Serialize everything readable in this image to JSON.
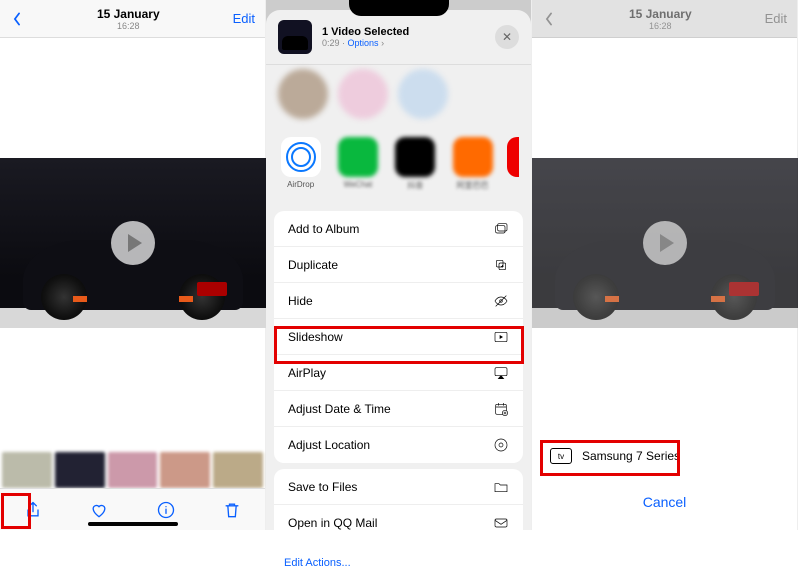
{
  "screen1": {
    "date": "15 January",
    "time": "16:28",
    "edit": "Edit"
  },
  "screen2": {
    "selected": "1 Video Selected",
    "duration": "0:29",
    "options": "Options",
    "airdrop_label": "AirDrop",
    "actions_group1": [
      "Add to Album",
      "Duplicate",
      "Hide",
      "Slideshow",
      "AirPlay",
      "Adjust Date & Time",
      "Adjust Location"
    ],
    "actions_group2": [
      "Save to Files",
      "Open in QQ Mail"
    ],
    "edit_actions": "Edit Actions..."
  },
  "screen3": {
    "date": "15 January",
    "time": "16:28",
    "edit": "Edit",
    "device": "Samsung 7 Series",
    "cancel": "Cancel"
  }
}
